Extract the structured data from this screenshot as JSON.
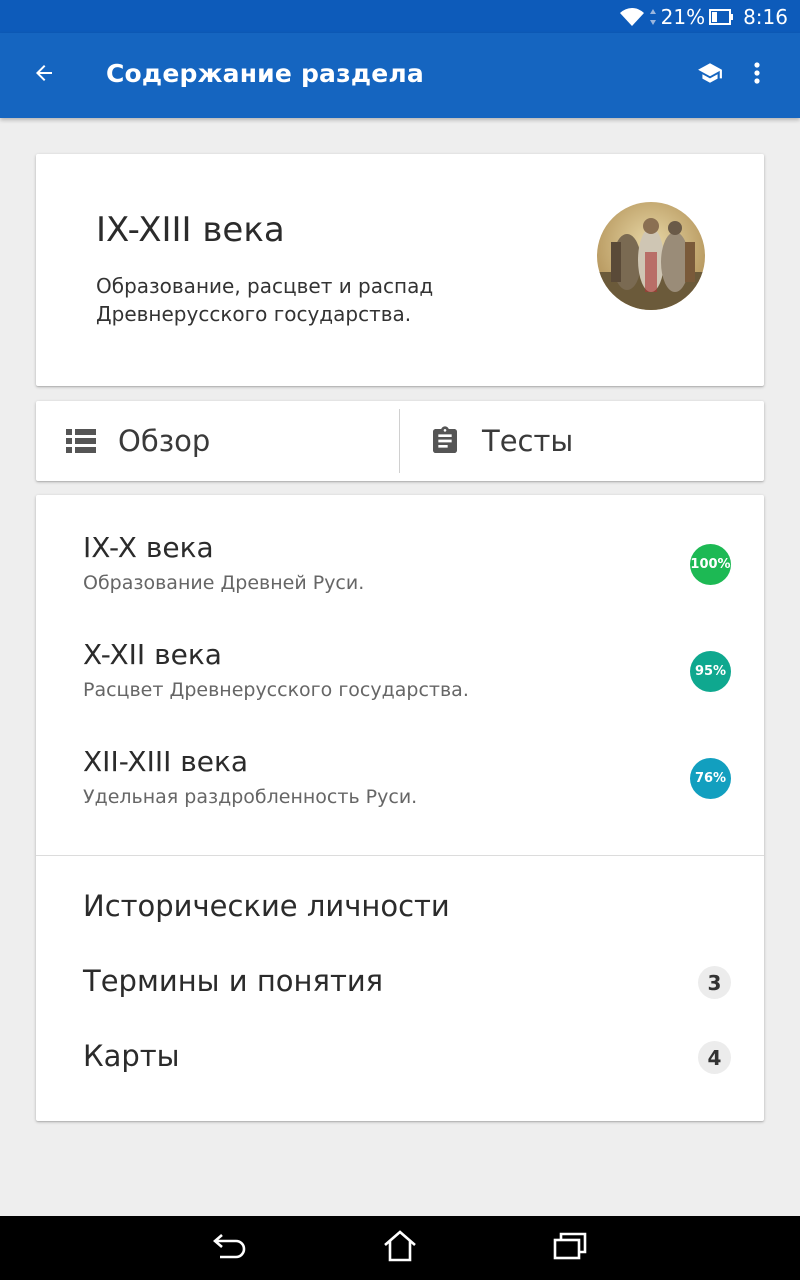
{
  "status_bar": {
    "battery": "21%",
    "time": "8:16",
    "icons": [
      "wifi-icon",
      "data-arrows-icon",
      "battery-icon"
    ]
  },
  "app_bar": {
    "title": "Содержание раздела",
    "icons": [
      "back-arrow-icon",
      "graduation-cap-icon",
      "more-vert-icon"
    ]
  },
  "header": {
    "title": "IX-XIII века",
    "description": "Образование, расцвет и распад Древнерусского государства."
  },
  "tabs": [
    {
      "label": "Обзор",
      "icon": "list-icon"
    },
    {
      "label": "Тесты",
      "icon": "clipboard-icon"
    }
  ],
  "sections": [
    {
      "title": "IX-X века",
      "subtitle": "Образование Древней Руси.",
      "progress": "100%",
      "color": "#1db954"
    },
    {
      "title": "X-XII века",
      "subtitle": "Расцвет Древнерусского государства.",
      "progress": "95%",
      "color": "#0fa88f"
    },
    {
      "title": "XII-XIII века",
      "subtitle": "Удельная раздробленность Руси.",
      "progress": "76%",
      "color": "#129fbf"
    }
  ],
  "links": [
    {
      "label": "Исторические личности",
      "count": ""
    },
    {
      "label": "Термины и понятия",
      "count": "3"
    },
    {
      "label": "Карты",
      "count": "4"
    }
  ],
  "nav_bar": {
    "icons": [
      "back-nav-icon",
      "home-nav-icon",
      "recents-nav-icon"
    ]
  }
}
